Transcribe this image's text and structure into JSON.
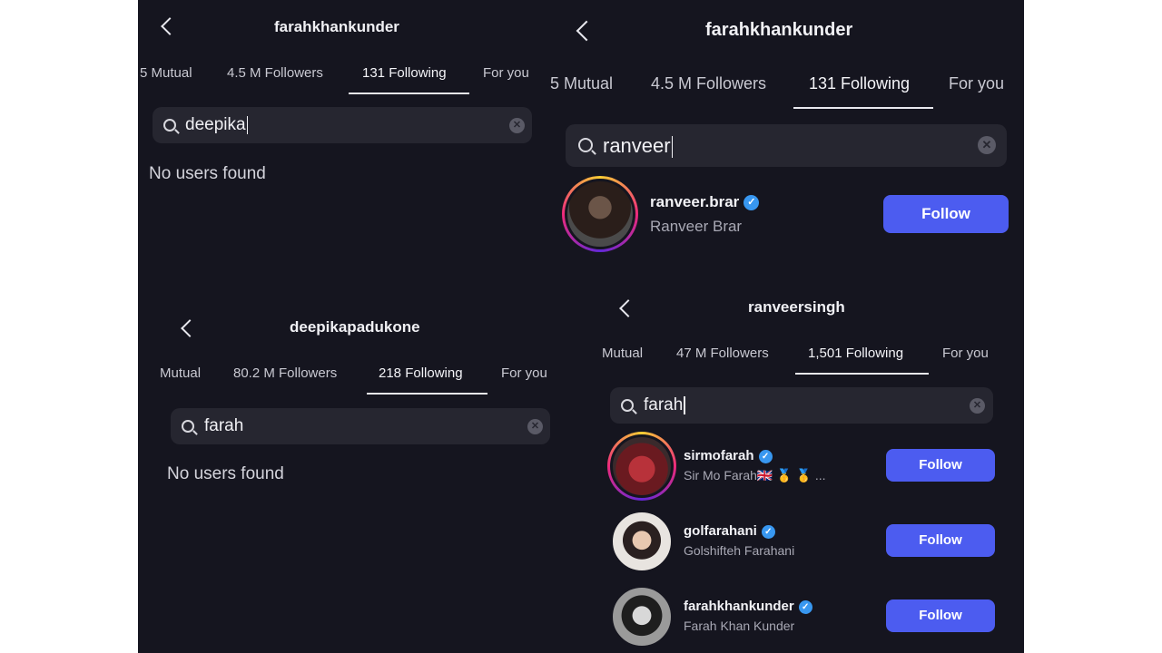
{
  "common": {
    "back_icon": "chevron-left-icon",
    "search_icon": "search-icon",
    "clear_icon": "clear-x-icon",
    "verified_icon": "verified-badge-icon",
    "follow_color": "#4c5cf0"
  },
  "p1": {
    "username": "farahkhankunder",
    "tabs": [
      "5 Mutual",
      "4.5 M Followers",
      "131 Following",
      "For you"
    ],
    "active_tab": 2,
    "query": "deepika",
    "empty": "No users found"
  },
  "p2": {
    "username": "farahkhankunder",
    "tabs": [
      "5 Mutual",
      "4.5 M Followers",
      "131 Following",
      "For you"
    ],
    "active_tab": 2,
    "query": "ranveer",
    "results": [
      {
        "handle": "ranveer.brar",
        "verified_mark": "✓",
        "name": "Ranveer Brar",
        "action": "Follow"
      }
    ]
  },
  "p3": {
    "username": "deepikapadukone",
    "tabs": [
      "Mutual",
      "80.2 M Followers",
      "218 Following",
      "For you"
    ],
    "active_tab": 2,
    "query": "farah",
    "empty": "No users found"
  },
  "p4": {
    "username": "ranveersingh",
    "tabs": [
      "Mutual",
      "47 M Followers",
      "1,501 Following",
      "For you"
    ],
    "active_tab": 2,
    "query": "farah",
    "results": [
      {
        "handle": "sirmofarah",
        "verified_mark": "✓",
        "name": "Sir Mo Farah🇬🇧 🥇 🥇 ...",
        "action": "Follow"
      },
      {
        "handle": "golfarahani",
        "verified_mark": "✓",
        "name": "Golshifteh Farahani",
        "action": "Follow"
      },
      {
        "handle": "farahkhankunder",
        "verified_mark": "✓",
        "name": "Farah Khan Kunder",
        "action": "Follow"
      }
    ]
  }
}
